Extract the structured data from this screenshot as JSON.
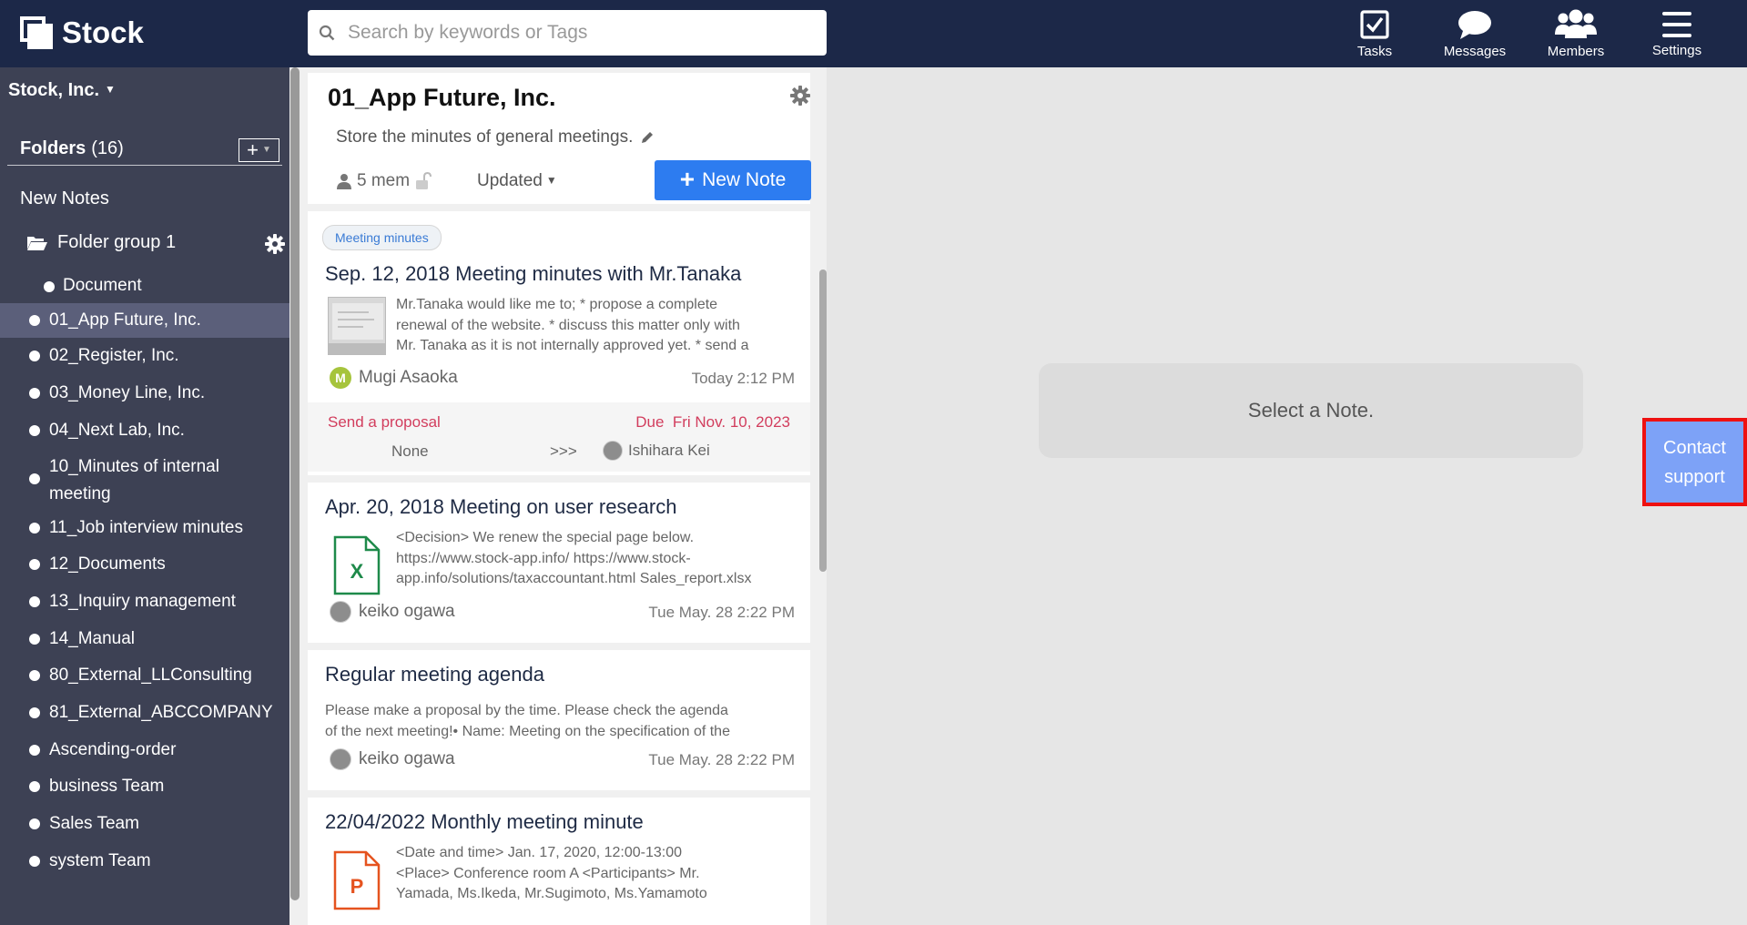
{
  "app": {
    "logo_text": "Stock"
  },
  "search": {
    "placeholder": "Search by keywords or Tags"
  },
  "nav": [
    {
      "label": "Tasks",
      "icon": "tasks-icon"
    },
    {
      "label": "Messages",
      "icon": "messages-icon"
    },
    {
      "label": "Members",
      "icon": "members-icon"
    },
    {
      "label": "Settings",
      "icon": "settings-icon"
    }
  ],
  "sidebar": {
    "org_name": "Stock, Inc.",
    "folders_label": "Folders",
    "folders_count": "(16)",
    "new_notes": "New Notes",
    "folder_group": "Folder group 1",
    "items": [
      "Document",
      "01_App Future, Inc.",
      "02_Register, Inc.",
      "03_Money Line, Inc.",
      "04_Next Lab, Inc.",
      "10_Minutes of internal",
      "meeting",
      "11_Job interview minutes",
      "12_Documents",
      "13_Inquiry management",
      "14_Manual",
      "80_External_LLConsulting",
      "81_External_ABCCOMPANY",
      "Ascending-order",
      "business Team",
      "Sales Team",
      "system Team"
    ]
  },
  "folder": {
    "title": "01_App Future, Inc.",
    "description": "Store the minutes of general meetings.",
    "members": "5 mem",
    "sort": "Updated",
    "new_note": "New Note"
  },
  "notes": [
    {
      "tag": "Meeting minutes",
      "title": "Sep. 12, 2018 Meeting minutes with Mr.Tanaka",
      "excerpt": [
        "Mr.Tanaka would like me to;        * propose a complete",
        "renewal of the website. * discuss this matter only with",
        "Mr. Tanaka as it is not internally approved yet. * send a"
      ],
      "author": "Mugi Asaoka",
      "author_initial": "M",
      "time": "Today 2:12 PM",
      "task": {
        "title": "Send a proposal",
        "due_label": "Due",
        "due": "Fri Nov. 10, 2023",
        "from": "None",
        "arrow": ">>>",
        "to": "Ishihara Kei"
      }
    },
    {
      "title": "Apr. 20, 2018 Meeting on user research",
      "file_letter": "X",
      "excerpt": [
        "<Decision> We renew the special page below.",
        "https://www.stock-app.info/ https://www.stock-",
        "app.info/solutions/taxaccountant.html Sales_report.xlsx"
      ],
      "author": "keiko ogawa",
      "time": "Tue May. 28 2:22 PM"
    },
    {
      "title": "Regular meeting agenda",
      "excerpt": [
        "Please make a proposal by the time.    Please check the agenda",
        "of the next meeting!• Name: Meeting on the specification of the"
      ],
      "author": "keiko ogawa",
      "time": "Tue May. 28 2:22 PM"
    },
    {
      "title": "22/04/2022 Monthly meeting minute",
      "file_letter": "P",
      "excerpt": [
        "<Date and time>     Jan. 17, 2020, 12:00-13:00",
        "<Place> Conference room A <Participants> Mr.",
        "Yamada, Ms.Ikeda, Mr.Sugimoto, Ms.Yamamoto"
      ]
    }
  ],
  "main": {
    "placeholder": "Select a Note."
  },
  "contact": {
    "line1": "Contact",
    "line2": "support"
  },
  "colors": {
    "header": "#1c2848",
    "sidebar": "#3d4154",
    "accent": "#2d7cf0",
    "contact": "#7da2f7",
    "highlight": "#ee1111",
    "task": "#d23d5d"
  }
}
